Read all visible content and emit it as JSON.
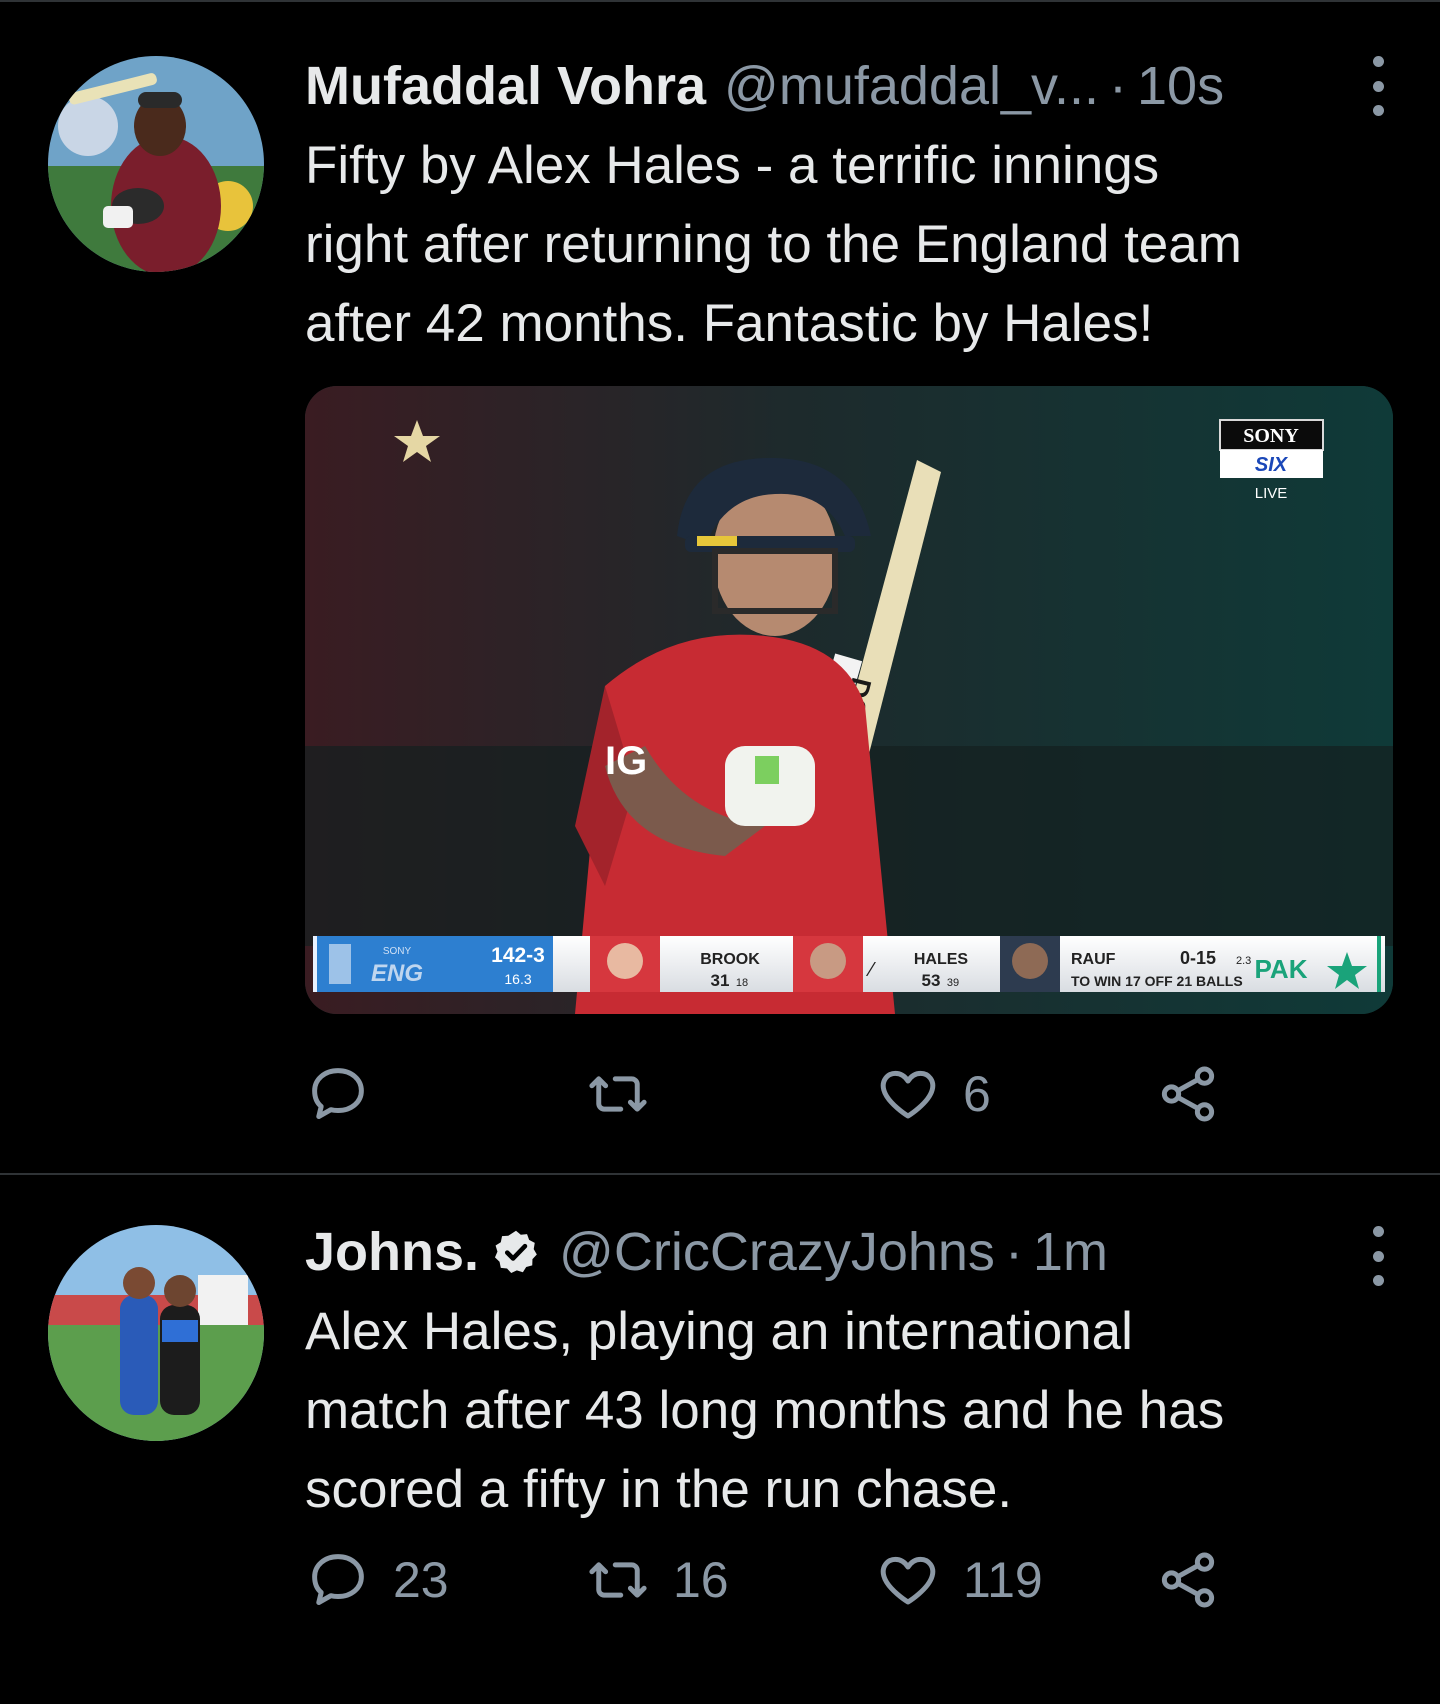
{
  "tweets": [
    {
      "author_name": "Mufaddal Vohra",
      "handle": "@mufaddal_v...",
      "separator": "·",
      "time": "10s",
      "verified": false,
      "text": "Fifty by Alex Hales - a terrific innings\nright after returning to the England team\nafter 42 months. Fantastic by Hales!",
      "media": {
        "broadcaster": {
          "brand": "SONY",
          "channel": "SIX",
          "status": "LIVE"
        },
        "scorebar": {
          "team_code": "ENG",
          "team_brand": "SONY",
          "score": "142-3",
          "overs": "16.3",
          "batter_1_name": "BROOK",
          "batter_1_runs": "31",
          "batter_1_balls": "18",
          "batter_2_name": "HALES",
          "batter_2_runs": "53",
          "batter_2_balls": "39",
          "bowler_name": "RAUF",
          "bowler_figures": "0-15",
          "bowler_overs": "2.3",
          "target_text": "TO WIN 17 OFF 21 BALLS",
          "opponent_code": "PAK"
        },
        "shirt_sponsor": "IG",
        "bat_brand": "DSC"
      },
      "actions": {
        "reply_count": "",
        "retweet_count": "",
        "like_count": "6"
      }
    },
    {
      "author_name": "Johns.",
      "handle": "@CricCrazyJohns",
      "separator": "·",
      "time": "1m",
      "verified": true,
      "text": "Alex Hales, playing an international\nmatch after 43 long months and he has\nscored a fifty in the run chase.",
      "actions": {
        "reply_count": "23",
        "retweet_count": "16",
        "like_count": "119"
      }
    }
  ],
  "icons": {
    "reply": "speech-bubble-icon",
    "retweet": "retweet-arrows-icon",
    "like": "heart-outline-icon",
    "share": "share-nodes-icon",
    "more": "vertical-dots-icon",
    "verified": "verified-badge-icon"
  },
  "colors": {
    "background": "#000000",
    "text_primary": "#e7e9ea",
    "text_secondary": "#8b98a5",
    "divider": "#2f3336",
    "england_red": "#d6373e",
    "scorebar_blue": "#2d7fd0",
    "pakistan_green": "#1aa37a"
  }
}
